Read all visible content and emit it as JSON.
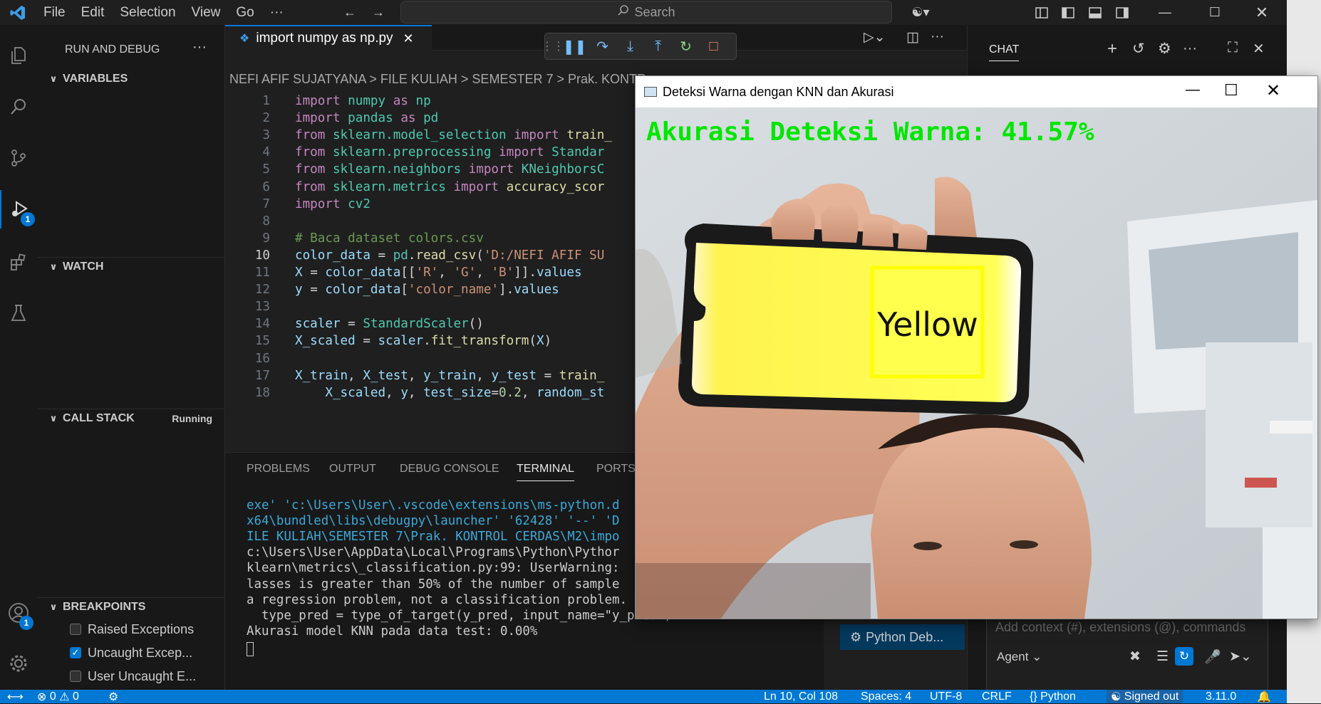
{
  "menu": [
    "File",
    "Edit",
    "Selection",
    "View",
    "Go",
    "···"
  ],
  "search_placeholder": "Search",
  "sidebar": {
    "title": "RUN AND DEBUG",
    "sections": {
      "variables": "VARIABLES",
      "watch": "WATCH",
      "call_stack": "CALL STACK",
      "call_stack_status": "Running",
      "breakpoints": "BREAKPOINTS"
    },
    "breakpoints": [
      {
        "label": "Raised Exceptions",
        "checked": false
      },
      {
        "label": "Uncaught Excep...",
        "checked": true
      },
      {
        "label": "User Uncaught E...",
        "checked": false
      }
    ],
    "debug_badge": "1",
    "account_badge": "1"
  },
  "editor": {
    "tab_label": "import numpy as np.py",
    "breadcrumb": "NEFI AFIF SUJATYANA > FILE KULIAH > SEMESTER 7 > Prak. KONTR",
    "lines": [
      {
        "n": "1",
        "html": "<span class='k'>import</span> <span class='t'>numpy</span> <span class='k'>as</span> <span class='t'>np</span>"
      },
      {
        "n": "2",
        "html": "<span class='k'>import</span> <span class='t'>pandas</span> <span class='k'>as</span> <span class='t'>pd</span>"
      },
      {
        "n": "3",
        "html": "<span class='k'>from</span> <span class='t'>sklearn.model_selection</span> <span class='k'>import</span> <span class='f'>train_</span>"
      },
      {
        "n": "4",
        "html": "<span class='k'>from</span> <span class='t'>sklearn.preprocessing</span> <span class='k'>import</span> <span class='t'>Standar</span>"
      },
      {
        "n": "5",
        "html": "<span class='k'>from</span> <span class='t'>sklearn.neighbors</span> <span class='k'>import</span> <span class='t'>KNeighborsC</span>"
      },
      {
        "n": "6",
        "html": "<span class='k'>from</span> <span class='t'>sklearn.metrics</span> <span class='k'>import</span> <span class='f'>accuracy_scor</span>"
      },
      {
        "n": "7",
        "html": "<span class='k'>import</span> <span class='t'>cv2</span>"
      },
      {
        "n": "8",
        "html": ""
      },
      {
        "n": "9",
        "html": "<span class='c'># Baca dataset colors.csv</span>"
      },
      {
        "n": "10",
        "html": "<span class='v'>color_data</span> <span class='p'>=</span> <span class='t'>pd</span><span class='p'>.</span><span class='f'>read_csv</span><span class='p'>(</span><span class='s'>'D:/NEFI AFIF SU</span>"
      },
      {
        "n": "11",
        "html": "<span class='v'>X</span> <span class='p'>=</span> <span class='v'>color_data</span><span class='p'>[[</span><span class='s'>'R'</span><span class='p'>, </span><span class='s'>'G'</span><span class='p'>, </span><span class='s'>'B'</span><span class='p'>]].</span><span class='v'>values</span>"
      },
      {
        "n": "12",
        "html": "<span class='v'>y</span> <span class='p'>=</span> <span class='v'>color_data</span><span class='p'>[</span><span class='s'>'color_name'</span><span class='p'>].</span><span class='v'>values</span>"
      },
      {
        "n": "13",
        "html": ""
      },
      {
        "n": "14",
        "html": "<span class='v'>scaler</span> <span class='p'>=</span> <span class='t'>StandardScaler</span><span class='p'>()</span>"
      },
      {
        "n": "15",
        "html": "<span class='v'>X_scaled</span> <span class='p'>=</span> <span class='v'>scaler</span><span class='p'>.</span><span class='f'>fit_transform</span><span class='p'>(</span><span class='v'>X</span><span class='p'>)</span>"
      },
      {
        "n": "16",
        "html": ""
      },
      {
        "n": "17",
        "html": "<span class='v'>X_train</span><span class='p'>, </span><span class='v'>X_test</span><span class='p'>, </span><span class='v'>y_train</span><span class='p'>, </span><span class='v'>y_test</span> <span class='p'>=</span> <span class='f'>train_</span>"
      },
      {
        "n": "18",
        "html": "    <span class='v'>X_scaled</span><span class='p'>, </span><span class='v'>y</span><span class='p'>, </span><span class='v'>test_size</span><span class='p'>=</span><span class='n'>0.2</span><span class='p'>, </span><span class='v'>random_st</span>"
      }
    ]
  },
  "panel": {
    "tabs": [
      "PROBLEMS",
      "OUTPUT",
      "DEBUG CONSOLE",
      "TERMINAL",
      "PORTS"
    ],
    "active_tab": "TERMINAL",
    "terminal_lines": [
      {
        "text": "exe' 'c:\\Users\\User\\.vscode\\extensions\\ms-python.d",
        "color": "#3ba9d9"
      },
      {
        "text": "x64\\bundled\\libs\\debugpy\\launcher' '62428' '--' 'D",
        "color": "#3ba9d9"
      },
      {
        "text": "ILE KULIAH\\SEMESTER 7\\Prak. KONTROL CERDAS\\M2\\impo",
        "color": "#3ba9d9"
      },
      {
        "text": "c:\\Users\\User\\AppData\\Local\\Programs\\Python\\Pythor",
        "color": "#cccccc"
      },
      {
        "text": "klearn\\metrics\\_classification.py:99: UserWarning:",
        "color": "#cccccc"
      },
      {
        "text": "lasses is greater than 50% of the number of sample",
        "color": "#cccccc"
      },
      {
        "text": "a regression problem, not a classification problem.",
        "color": "#cccccc"
      },
      {
        "text": "  type_pred = type_of_target(y_pred, input_name=\"y_pred\")",
        "color": "#cccccc"
      },
      {
        "text": "Akurasi model KNN pada data test: 0.00%",
        "color": "#cccccc"
      }
    ]
  },
  "chat": {
    "title": "CHAT",
    "input_placeholder": "Add context (#), extensions (@), commands",
    "agent_label": "Agent",
    "terminal_item": "Python Deb..."
  },
  "cv_window": {
    "title": "Deteksi Warna dengan KNN dan Akurasi",
    "accuracy_text": "Akurasi Deteksi Warna: 41.57%",
    "detected_label": "Yellow"
  },
  "statusbar": {
    "errors": "0",
    "warnings": "0",
    "position": "Ln 10, Col 108",
    "spaces": "Spaces: 4",
    "encoding": "UTF-8",
    "eol": "CRLF",
    "language": "Python",
    "account": "Signed out",
    "version": "3.11.0"
  },
  "colors": {
    "accent": "#0078d4",
    "accuracy_green": "#00e600",
    "phone_screen_yellow": "#ffff4d"
  }
}
